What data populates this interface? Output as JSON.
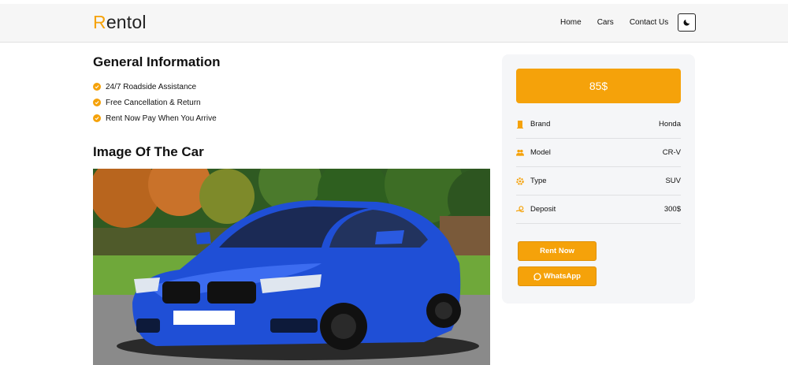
{
  "navbar": {
    "brand_first": "R",
    "brand_rest": "entol",
    "links": [
      "Home",
      "Cars",
      "Contact Us"
    ],
    "theme_icon": "moon-icon"
  },
  "general": {
    "title": "General Information",
    "items": [
      "24/7 Roadside Assistance",
      "Free Cancellation & Return",
      "Rent Now Pay When You Arrive"
    ]
  },
  "image_section": {
    "title": "Image Of The Car"
  },
  "card": {
    "price": "85$",
    "details": [
      {
        "label": "Brand",
        "value": "Honda",
        "icon": "building-icon"
      },
      {
        "label": "Model",
        "value": "CR-V",
        "icon": "users-icon"
      },
      {
        "label": "Type",
        "value": "SUV",
        "icon": "gear-icon"
      },
      {
        "label": "Deposit",
        "value": "300$",
        "icon": "money-icon"
      }
    ],
    "rent_button": "Rent Now",
    "whatsapp_button": "WhatsApp"
  },
  "colors": {
    "accent": "#f5a20a",
    "car_body": "#1f4fd6"
  }
}
